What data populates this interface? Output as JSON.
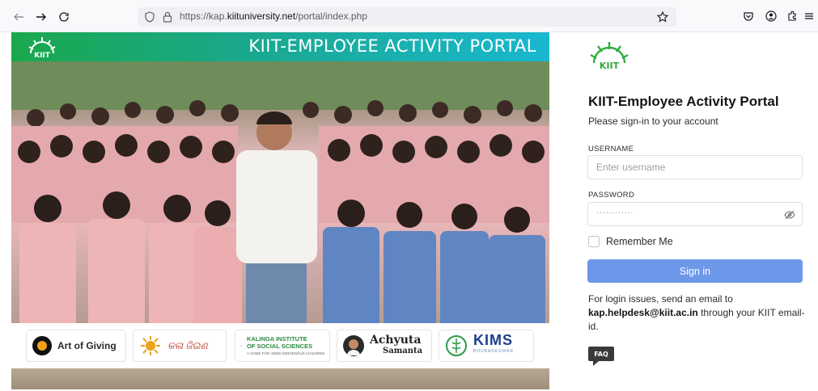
{
  "browser": {
    "url_prefix": "https://kap.",
    "url_domain": "kiituniversity.net",
    "url_path": "/portal/index.php",
    "icons": [
      "back-icon",
      "forward-icon",
      "reload-icon",
      "shield-icon",
      "lock-icon",
      "bookmark-star-icon",
      "pocket-icon",
      "account-icon",
      "extensions-icon",
      "menu-icon"
    ]
  },
  "hero": {
    "banner_title": "KIIT-EMPLOYEE ACTIVITY PORTAL",
    "sponsors": [
      {
        "name": "Art of Giving"
      },
      {
        "name": "କଳା ଜିଇଣ"
      },
      {
        "name_line1": "KALINGA INSTITUTE",
        "name_line2": "OF SOCIAL SCIENCES",
        "tagline": "A HOME FOR 40000 INDIGENOUS CHILDREN"
      },
      {
        "name_line1": "Achyuta",
        "name_line2": "Samanta"
      },
      {
        "name": "KIMS",
        "tagline": "BHUBANESWAR"
      }
    ]
  },
  "login": {
    "title": "KIIT-Employee Activity Portal",
    "subtitle": "Please sign-in to your account",
    "username_label": "USERNAME",
    "username_placeholder": "Enter username",
    "password_label": "PASSWORD",
    "password_masked": "············",
    "remember_label": "Remember Me",
    "signin_label": "Sign in",
    "help_prefix": "For login issues, send an email to",
    "help_email": "kap.helpdesk@kiit.ac.in",
    "help_suffix": "through your KIIT email-id.",
    "faq_label": "FAQ"
  },
  "colors": {
    "primary_button": "#6d97e8",
    "banner_start": "#1aa84c",
    "banner_end": "#19b8d0",
    "brand_green": "#2fae3e"
  }
}
